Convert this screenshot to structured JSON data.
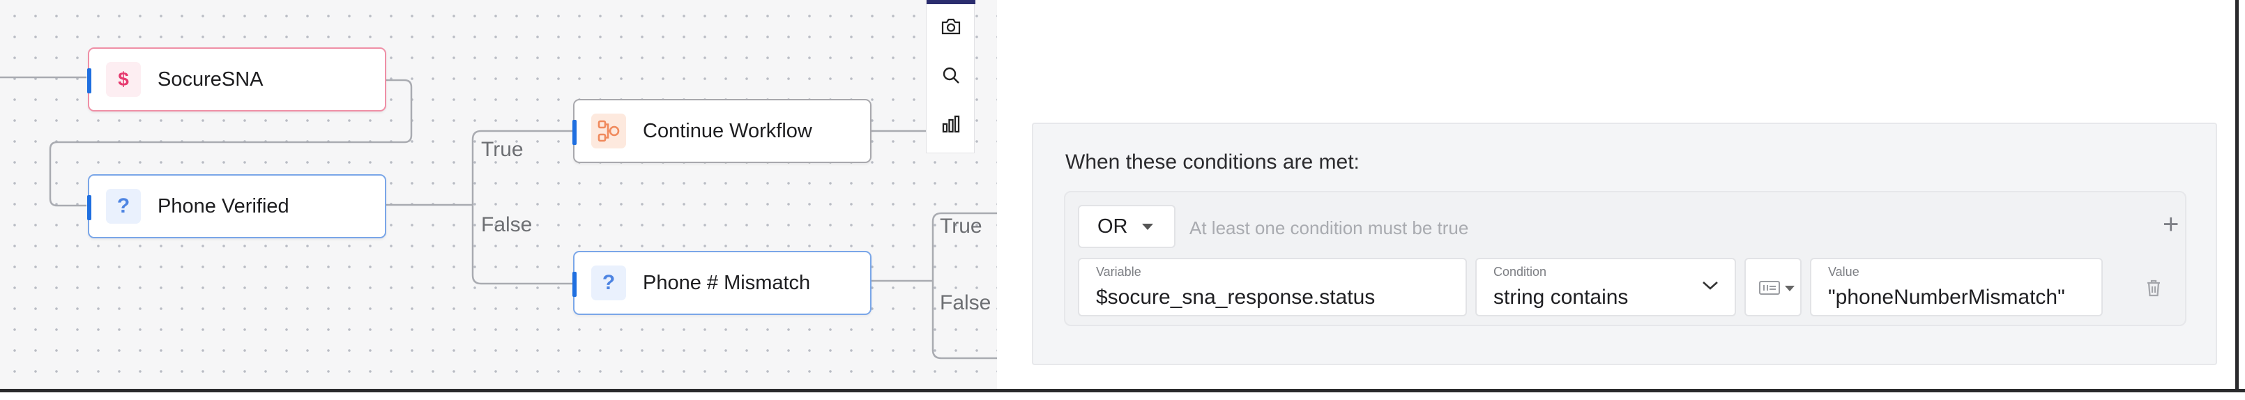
{
  "canvas": {
    "nodes": {
      "socure_sna": {
        "label": "SocureSNA",
        "icon": "dollar-sign-icon",
        "icon_glyph": "$"
      },
      "phone_verified": {
        "label": "Phone Verified",
        "icon": "question-mark-icon",
        "icon_glyph": "?"
      },
      "continue_workflow": {
        "label": "Continue Workflow",
        "icon": "workflow-icon"
      },
      "phone_mismatch": {
        "label": "Phone # Mismatch",
        "icon": "question-mark-icon",
        "icon_glyph": "?"
      }
    },
    "branches": {
      "verified_true": "True",
      "verified_false": "False",
      "mismatch_true": "True",
      "mismatch_false": "False"
    },
    "toolbar": [
      "camera-icon",
      "search-icon",
      "chart-icon"
    ],
    "colors": {
      "pink_accent": "#e63a6f",
      "blue_accent": "#4d84e2",
      "port_blue": "#1f6fe0",
      "workflow_orange": "#f08a5d"
    }
  },
  "conditions": {
    "title": "When these conditions are met:",
    "operator": "OR",
    "operator_hint": "At least one condition must be true",
    "add_icon": "+",
    "rows": [
      {
        "variable_label": "Variable",
        "variable": "$socure_sna_response.status",
        "condition_label": "Condition",
        "condition": "string contains",
        "value_label": "Value",
        "value": "\"phoneNumberMismatch\""
      }
    ]
  }
}
